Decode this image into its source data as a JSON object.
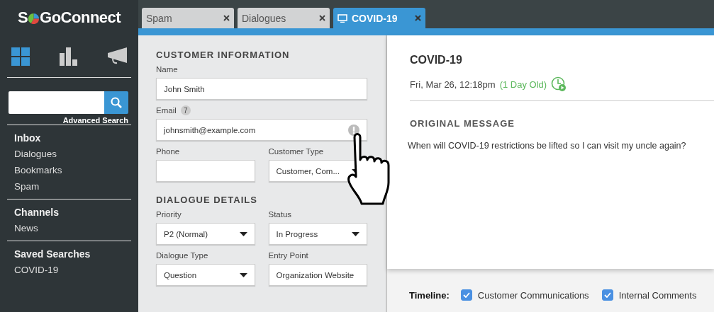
{
  "logo": {
    "before": "S",
    "after": "GoConnect"
  },
  "nav_icons": [
    {
      "kind": "grid",
      "selected": true
    },
    {
      "kind": "chart",
      "selected": false
    },
    {
      "kind": "megaphone",
      "selected": false
    }
  ],
  "search": {
    "link": "Advanced Search"
  },
  "sidebar": [
    {
      "heading": "Inbox",
      "items": [
        "Dialogues",
        "Bookmarks",
        "Spam"
      ]
    },
    {
      "heading": "Channels",
      "items": [
        "News"
      ]
    },
    {
      "heading": "Saved Searches",
      "items": [
        "COVID-19"
      ]
    }
  ],
  "tabs": [
    {
      "label": "Spam",
      "selected": false
    },
    {
      "label": "Dialogues",
      "selected": false
    },
    {
      "label": "COVID-19",
      "selected": true
    }
  ],
  "form": [
    {
      "title": "CUSTOMER INFORMATION",
      "rows": [
        [
          {
            "label": "Name",
            "kind": "text",
            "value": "John Smith"
          }
        ],
        [
          {
            "label": "Email",
            "badge": "7",
            "kind": "text",
            "value": "johnsmith@example.com",
            "warning": true
          }
        ],
        [
          {
            "label": "Phone",
            "kind": "text"
          },
          {
            "label": "Customer Type",
            "kind": "select",
            "value": "Customer, Com..."
          }
        ]
      ]
    },
    {
      "title": "DIALOGUE DETAILS",
      "rows": [
        [
          {
            "label": "Priority",
            "kind": "select",
            "value": "P2 (Normal)"
          },
          {
            "label": "Status",
            "kind": "select",
            "value": "In Progress"
          }
        ],
        [
          {
            "label": "Dialogue Type",
            "kind": "select",
            "value": "Question"
          },
          {
            "label": "Entry Point",
            "kind": "text",
            "value": "Organization Website"
          }
        ]
      ]
    }
  ],
  "detail": {
    "title": "COVID-19",
    "date": "Fri, Mar 26, 12:18pm",
    "age": "(1 Day Old)",
    "section": "ORIGINAL MESSAGE",
    "message": "When will COVID-19 restrictions be lifted so I can visit my uncle again?"
  },
  "timeline": {
    "label": "Timeline:",
    "options": [
      {
        "label": "Customer Communications",
        "checked": true
      },
      {
        "label": "Internal Comments",
        "checked": true
      }
    ]
  }
}
